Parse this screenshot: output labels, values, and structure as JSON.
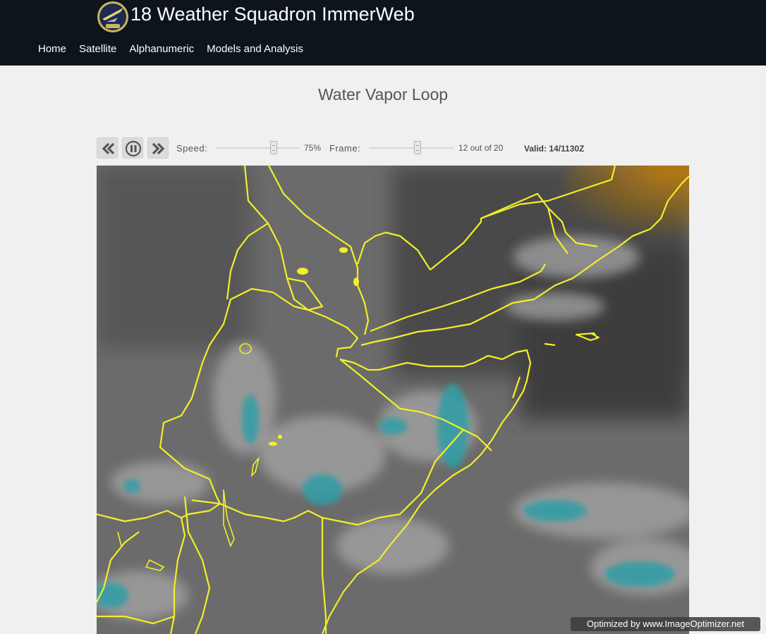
{
  "header": {
    "site_title": "18 Weather Squadron ImmerWeb",
    "logo_icon": "squadron-emblem-icon"
  },
  "nav": {
    "items": [
      {
        "label": "Home"
      },
      {
        "label": "Satellite"
      },
      {
        "label": "Alphanumeric"
      },
      {
        "label": "Models and Analysis"
      }
    ]
  },
  "main": {
    "title": "Water Vapor Loop"
  },
  "controls": {
    "rewind_icon": "rewind-icon",
    "pause_icon": "pause-icon",
    "forward_icon": "fast-forward-icon",
    "speed_label": "Speed:",
    "speed_value": "75%",
    "speed_fraction": 0.75,
    "frame_label": "Frame:",
    "frame_value": "12 out of 20",
    "frame_current": 12,
    "frame_total": 20,
    "valid_text": "Valid: 14/1130Z"
  },
  "image": {
    "description_icon": "satellite-water-vapor-image",
    "border_color": "#f2ee2a",
    "dry_color": "#c98a12",
    "moist_color": "#2e9ea6"
  },
  "watermark": {
    "text": "Optimized by www.ImageOptimizer.net"
  }
}
